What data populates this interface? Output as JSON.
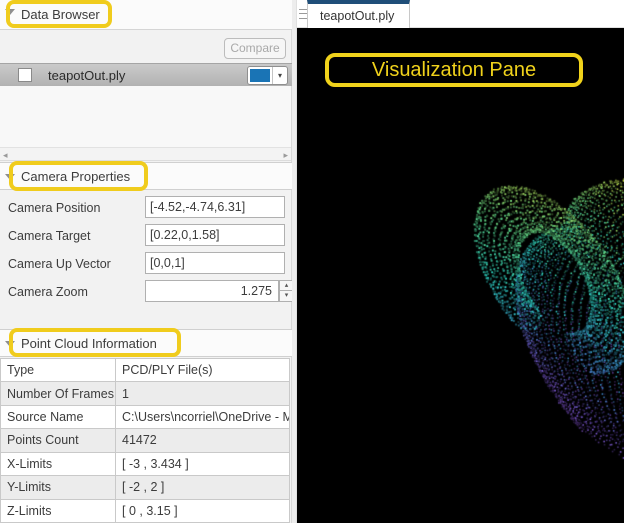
{
  "data_browser": {
    "title": "Data Browser",
    "compare_label": "Compare",
    "file": {
      "name": "teapotOut.ply",
      "checked": false,
      "swatch_color": "#1a74b5"
    }
  },
  "camera_properties": {
    "title": "Camera Properties",
    "rows": [
      {
        "label": "Camera Position",
        "value": "[-4.52,-4.74,6.31]"
      },
      {
        "label": "Camera Target",
        "value": "[0.22,0,1.58]"
      },
      {
        "label": "Camera Up Vector",
        "value": "[0,0,1]"
      },
      {
        "label": "Camera Zoom",
        "value": "1.275"
      }
    ]
  },
  "point_cloud_information": {
    "title": "Point Cloud Information",
    "rows": [
      {
        "label": "Type",
        "value": "PCD/PLY File(s)"
      },
      {
        "label": "Number Of Frames",
        "value": "1"
      },
      {
        "label": "Source Name",
        "value": "C:\\Users\\ncorriel\\OneDrive - Ma"
      },
      {
        "label": "Points Count",
        "value": "41472"
      },
      {
        "label": "X-Limits",
        "value": "[ -3 , 3.434 ]"
      },
      {
        "label": "Y-Limits",
        "value": "[ -2 , 2 ]"
      },
      {
        "label": "Z-Limits",
        "value": "[ 0 , 3.15 ]"
      }
    ]
  },
  "viewer": {
    "tab_label": "teapotOut.ply",
    "tab_accent_color": "#1f4e79",
    "background_color": "#000000",
    "pointcloud": {
      "point_size": 1.6,
      "colormap": [
        "#f6dd3e",
        "#cfe04a",
        "#62e08e",
        "#30e2cf",
        "#3f8fd4",
        "#7e63e0",
        "#8b55d6",
        "#5638a8"
      ]
    }
  },
  "annotations": {
    "highlight_color": "#f0cc1d",
    "visualization_pane_label": "Visualization Pane"
  }
}
